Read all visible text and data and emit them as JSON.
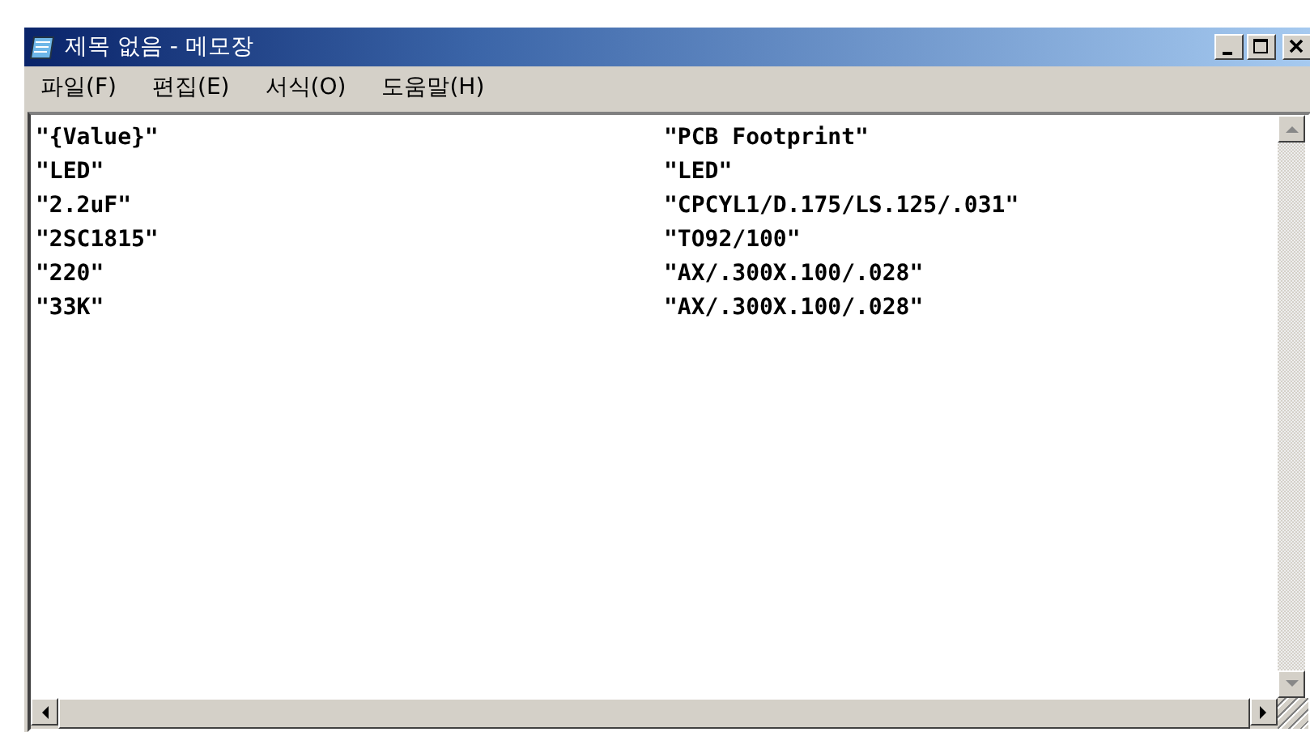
{
  "window": {
    "title": "제목 없음 - 메모장"
  },
  "menu": [
    "파일(F)",
    "편집(E)",
    "서식(O)",
    "도움말(H)"
  ],
  "lines": [
    {
      "column_1": "\"{Value}\"",
      "column_2": "\"PCB Footprint\""
    },
    {
      "column_1": "\"LED\"",
      "column_2": "\"LED\""
    },
    {
      "column_1": "\"2.2uF\"",
      "column_2": "\"CPCYL1/D.175/LS.125/.031\""
    },
    {
      "column_1": "\"2SC1815\"",
      "column_2": "\"TO92/100\""
    },
    {
      "column_1": "\"220\"",
      "column_2": "\"AX/.300X.100/.028\""
    },
    {
      "column_1": "\"33K\"",
      "column_2": "\"AX/.300X.100/.028\""
    }
  ]
}
